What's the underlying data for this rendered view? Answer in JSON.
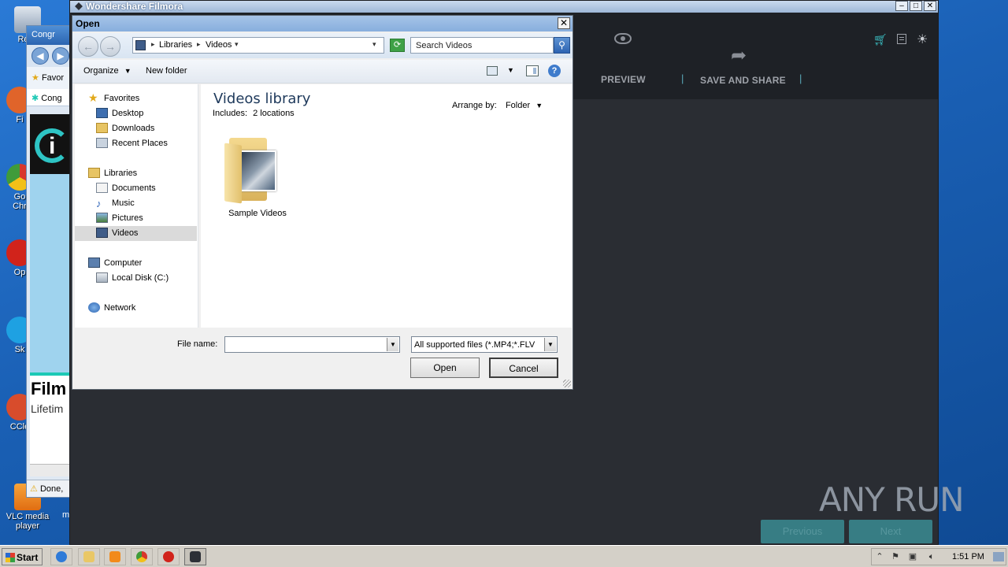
{
  "desktop": {
    "icons": [
      {
        "label": "Recy",
        "color": "#cfd8e3"
      },
      {
        "label": "Fi",
        "color": "#e0642a"
      },
      {
        "label": "Go\nChr",
        "color": "#3f9b3a"
      },
      {
        "label": "Op",
        "color": "#d1231b"
      },
      {
        "label": "Sk",
        "color": "#1ea1e2"
      },
      {
        "label": "CCle",
        "color": "#d84c2c"
      },
      {
        "label": "VLC media\nplayer",
        "color": "#f08a1a"
      }
    ],
    "extra_label": "m"
  },
  "ie_window": {
    "title": "Congr",
    "favorites": "Favor",
    "tab": "Cong",
    "promo_heading": "Film",
    "promo_sub": "Lifetim",
    "status": "Done,"
  },
  "filmora": {
    "title": "Wondershare Filmora",
    "preview_label": "PREVIEW",
    "share_label": "SAVE AND SHARE",
    "separator": "|",
    "previous_label": "Previous",
    "next_label": "Next",
    "accent": "#3bc3c7"
  },
  "dialog": {
    "title": "Open",
    "close": "✕",
    "breadcrumb": [
      "Libraries",
      "Videos"
    ],
    "search_placeholder": "Search Videos",
    "organize": "Organize",
    "new_folder": "New folder",
    "nav": {
      "favorites": {
        "label": "Favorites",
        "items": [
          "Desktop",
          "Downloads",
          "Recent Places"
        ]
      },
      "libraries": {
        "label": "Libraries",
        "items": [
          "Documents",
          "Music",
          "Pictures",
          "Videos"
        ],
        "selected": "Videos"
      },
      "computer": {
        "label": "Computer",
        "items": [
          "Local Disk (C:)"
        ]
      },
      "network": {
        "label": "Network"
      }
    },
    "library_title": "Videos library",
    "includes_label": "Includes:",
    "includes_value": "2 locations",
    "arrange_label": "Arrange by:",
    "arrange_value": "Folder",
    "folder_name": "Sample Videos",
    "file_name_label": "File name:",
    "file_name_value": "",
    "filter": "All supported files (*.MP4;*.FLV",
    "open_button": "Open",
    "cancel_button": "Cancel"
  },
  "watermark": "ANY RUN",
  "taskbar": {
    "start": "Start",
    "apps": [
      {
        "name": "internet-explorer",
        "color": "#2f7bd8",
        "active": false
      },
      {
        "name": "explorer",
        "color": "#e9c766",
        "active": false
      },
      {
        "name": "media-player",
        "color": "#f28a1b",
        "active": false
      },
      {
        "name": "chrome",
        "color": "#3f9b3a",
        "active": false
      },
      {
        "name": "opera",
        "color": "#d1231b",
        "active": false
      },
      {
        "name": "filmora",
        "color": "#2c2f36",
        "active": true
      }
    ],
    "clock": "1:51 PM"
  }
}
